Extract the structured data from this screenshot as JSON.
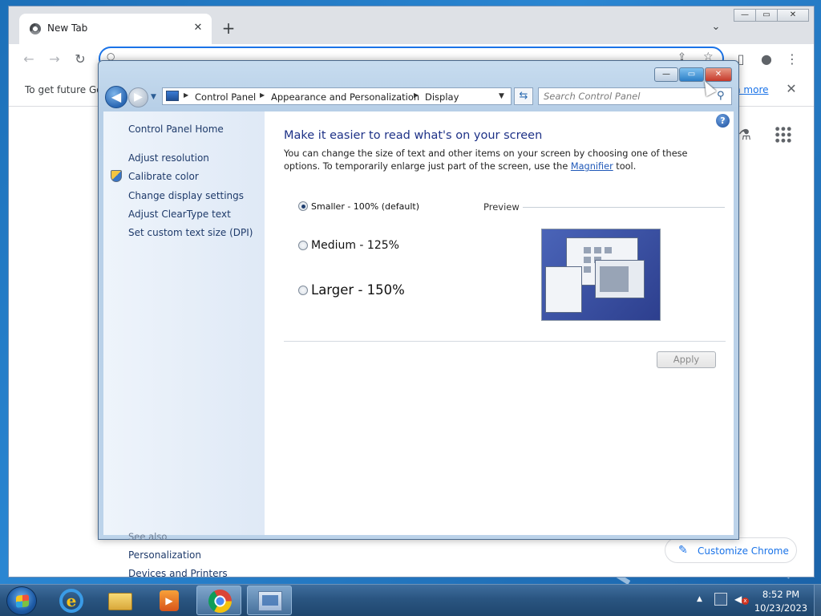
{
  "chrome": {
    "tab_title": "New Tab",
    "tab_close_icon": "✕",
    "new_tab_icon": "+",
    "tab_search_icon": "⌄",
    "window_controls": {
      "minimize": "—",
      "maximize": "▭",
      "close": "✕"
    },
    "toolbar": {
      "back": "←",
      "forward": "→",
      "reload": "↻",
      "search_icon": "○",
      "share": "⇪",
      "bookmark": "☆",
      "sidepanel": "▯",
      "profile": "●",
      "menu": "⋮"
    },
    "infobar": {
      "text": "To get future Go",
      "link": "n more",
      "close": "✕"
    },
    "labs_icon": "⚗",
    "customize": {
      "icon": "✎",
      "label": "Customize Chrome"
    },
    "accent": "#1a73e8"
  },
  "control_panel": {
    "window_controls": {
      "minimize": "—",
      "maximize": "▭",
      "close": "✕"
    },
    "nav": {
      "back": "◀",
      "forward": "▶",
      "history": "▼"
    },
    "breadcrumbs": [
      "Control Panel",
      "Appearance and Personalization",
      "Display"
    ],
    "breadcrumb_separator": "▶",
    "address_dropdown": "▼",
    "refresh_icon": "⇆",
    "search_placeholder": "Search Control Panel",
    "search_icon": "⚲",
    "sidebar": {
      "home": "Control Panel Home",
      "links": [
        "Adjust resolution",
        "Calibrate color",
        "Change display settings",
        "Adjust ClearType text",
        "Set custom text size (DPI)"
      ],
      "see_also_label": "See also",
      "see_also": [
        "Personalization",
        "Devices and Printers"
      ]
    },
    "main": {
      "help": "?",
      "heading": "Make it easier to read what's on your screen",
      "description_before": "You can change the size of text and other items on your screen by choosing one of these options. To temporarily enlarge just part of the screen, use the ",
      "magnifier_link": "Magnifier",
      "description_after": " tool.",
      "options": [
        {
          "label": "Smaller - 100% (default)",
          "checked": true
        },
        {
          "label": "Medium - 125%",
          "checked": false
        },
        {
          "label": "Larger - 150%",
          "checked": false
        }
      ],
      "preview_label": "Preview",
      "apply_label": "Apply"
    }
  },
  "taskbar": {
    "ie_glyph": "e",
    "media_glyph": "▶",
    "tray_arrow": "▲",
    "volume_glyph": "◀",
    "mute_glyph": "x",
    "clock_time": "8:52 PM",
    "clock_date": "10/23/2023"
  }
}
